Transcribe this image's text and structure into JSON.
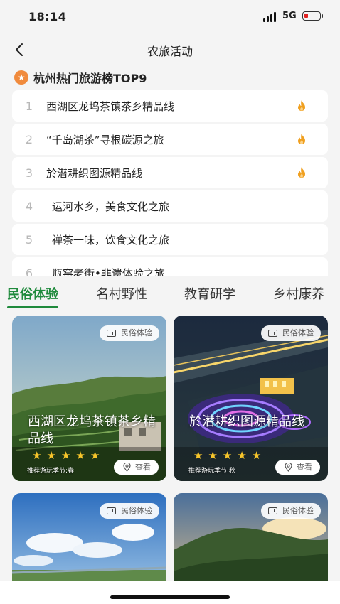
{
  "status": {
    "time": "18:14",
    "network": "5G"
  },
  "nav": {
    "title": "农旅活动"
  },
  "ranking": {
    "title": "杭州热门旅游榜TOP9",
    "items": [
      {
        "rank": "1",
        "name": "西湖区龙坞茶镇茶乡精品线",
        "hot": true
      },
      {
        "rank": "2",
        "name": "“千岛湖茶”寻根碳源之旅",
        "hot": true
      },
      {
        "rank": "3",
        "name": "於潜耕织图源精品线",
        "hot": true
      },
      {
        "rank": "4",
        "name": "运河水乡，美食文化之旅",
        "hot": false
      },
      {
        "rank": "5",
        "name": "禅茶一味，饮食文化之旅",
        "hot": false
      },
      {
        "rank": "6",
        "name": "瓶窑老街•非遗体验之旅",
        "hot": false
      }
    ]
  },
  "tabs": [
    {
      "label": "民俗体验",
      "active": true
    },
    {
      "label": "名村野性",
      "active": false
    },
    {
      "label": "教育研学",
      "active": false
    },
    {
      "label": "乡村康养",
      "active": false
    }
  ],
  "cards": [
    {
      "tag": "民俗体验",
      "title": "西湖区龙坞茶镇茶乡精品线",
      "rating": 5,
      "season": "推荐游玩季节:春",
      "view": "查看"
    },
    {
      "tag": "民俗体验",
      "title": "於潜耕织图源精品线",
      "rating": 5,
      "season": "推荐游玩季节:秋",
      "view": "查看"
    },
    {
      "tag": "民俗体验"
    },
    {
      "tag": "民俗体验"
    }
  ],
  "colors": {
    "accent": "#1f8a3c",
    "star": "#f7c52b",
    "fire": "#f0a020",
    "badge": "#f08a3c"
  },
  "icons": [
    "back-arrow-icon",
    "star-badge-icon",
    "fire-icon",
    "ticket-icon",
    "location-pin-icon",
    "signal-icon",
    "battery-icon"
  ]
}
